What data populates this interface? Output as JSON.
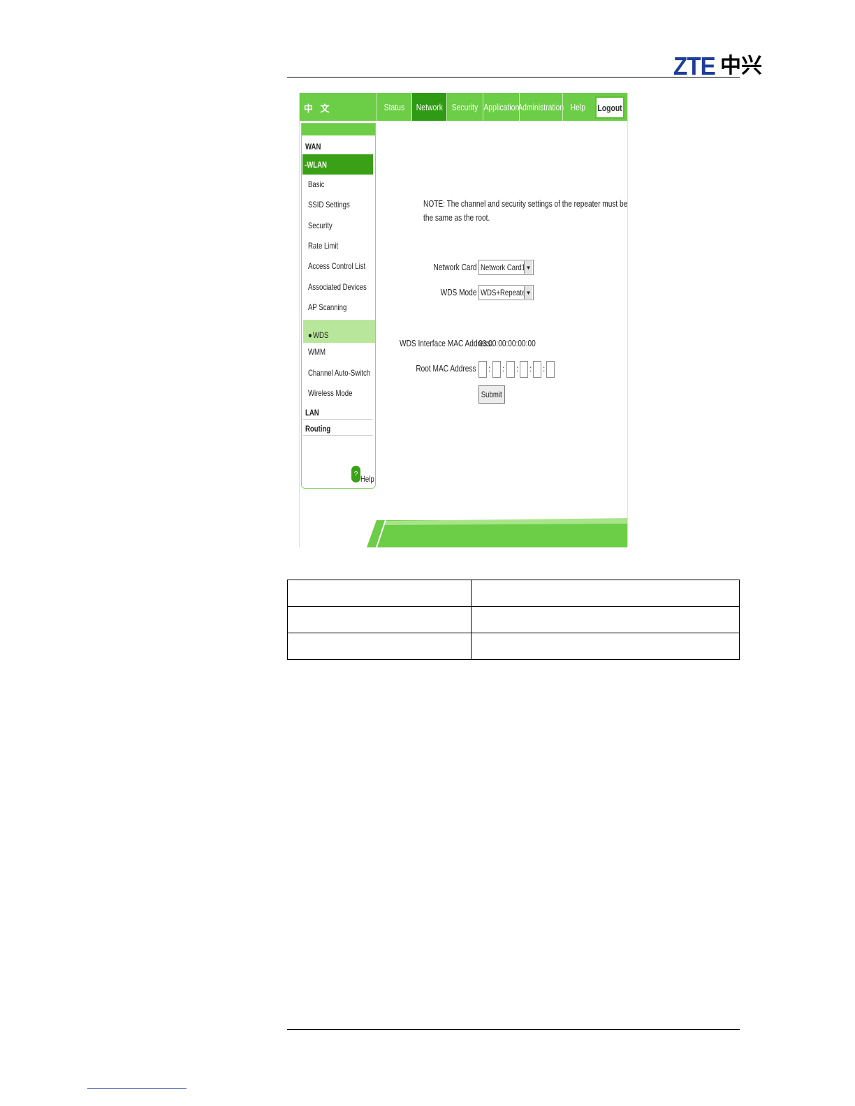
{
  "document": {
    "logo_latin": "ZTE",
    "logo_chinese": "中兴"
  },
  "screenshot": {
    "language_link": "中 文",
    "nav": {
      "tabs": [
        "Status",
        "Network",
        "Security",
        "Application",
        "Administration",
        "Help"
      ],
      "active": "Network",
      "logout": "Logout"
    },
    "sidebar": {
      "categories": [
        "WAN",
        "LAN",
        "Routing"
      ],
      "active_category": "-WLAN",
      "items": [
        "Basic",
        "SSID Settings",
        "Security",
        "Rate Limit",
        "Access Control List",
        "Associated Devices",
        "AP Scanning",
        "WMM",
        "Channel Auto-Switch",
        "Wireless Mode"
      ],
      "active_item": "WDS",
      "help_label": "Help",
      "help_icon_glyph": "?"
    },
    "main": {
      "note": "NOTE:  The channel and security settings of the repeater must be",
      "note_line2": "the same as the root.",
      "network_card_label": "Network Card",
      "network_card_value": "Network Card1",
      "wds_mode_label": "WDS Mode",
      "wds_mode_value": "WDS+Repeater",
      "mac_label": "WDS Interface MAC Address:",
      "mac_value": "00:00:00:00:00:00",
      "root_mac_label": "Root MAC Address",
      "root_mac_fields": [
        "",
        "",
        "",
        "",
        "",
        ""
      ],
      "mac_separator": ":",
      "submit_label": "Submit"
    },
    "colors": {
      "green": "#6ccd46",
      "dark_green": "#2f9a14",
      "light_green": "#b8e79c"
    }
  },
  "table": {
    "rows": [
      [
        "",
        ""
      ],
      [
        "",
        ""
      ],
      [
        "",
        ""
      ]
    ]
  }
}
